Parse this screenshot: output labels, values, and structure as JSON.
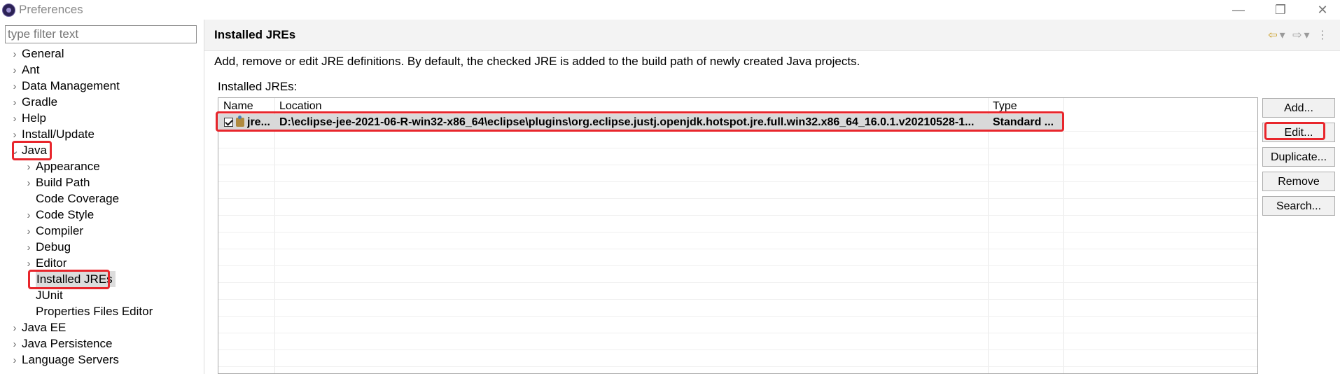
{
  "window": {
    "title": "Preferences"
  },
  "sidebar": {
    "filter_placeholder": "type filter text",
    "items": [
      {
        "label": "General"
      },
      {
        "label": "Ant"
      },
      {
        "label": "Data Management"
      },
      {
        "label": "Gradle"
      },
      {
        "label": "Help"
      },
      {
        "label": "Install/Update"
      },
      {
        "label": "Java"
      },
      {
        "label": "Appearance"
      },
      {
        "label": "Build Path"
      },
      {
        "label": "Code Coverage"
      },
      {
        "label": "Code Style"
      },
      {
        "label": "Compiler"
      },
      {
        "label": "Debug"
      },
      {
        "label": "Editor"
      },
      {
        "label": "Installed JREs"
      },
      {
        "label": "JUnit"
      },
      {
        "label": "Properties Files Editor"
      },
      {
        "label": "Java EE"
      },
      {
        "label": "Java Persistence"
      },
      {
        "label": "Language Servers"
      }
    ]
  },
  "main": {
    "title": "Installed JREs",
    "description": "Add, remove or edit JRE definitions. By default, the checked JRE is added to the build path of newly created Java projects.",
    "table_label": "Installed JREs:",
    "columns": [
      "Name",
      "Location",
      "Type"
    ],
    "rows": [
      {
        "checked": true,
        "name": "jre...",
        "location": "D:\\eclipse-jee-2021-06-R-win32-x86_64\\eclipse\\plugins\\org.eclipse.justj.openjdk.hotspot.jre.full.win32.x86_64_16.0.1.v20210528-1...",
        "type": "Standard ..."
      }
    ],
    "buttons": {
      "add": "Add...",
      "edit": "Edit...",
      "duplicate": "Duplicate...",
      "remove": "Remove",
      "search": "Search..."
    }
  },
  "icons": [
    "app-icon",
    "back-icon",
    "forward-icon",
    "menu-icon",
    "chevron-right-icon",
    "chevron-down-icon",
    "checkbox-icon",
    "jre-icon"
  ],
  "colors": {
    "highlight": "#e8262c",
    "selection": "#d9d9d9",
    "header_bg": "#f3f3f3"
  }
}
